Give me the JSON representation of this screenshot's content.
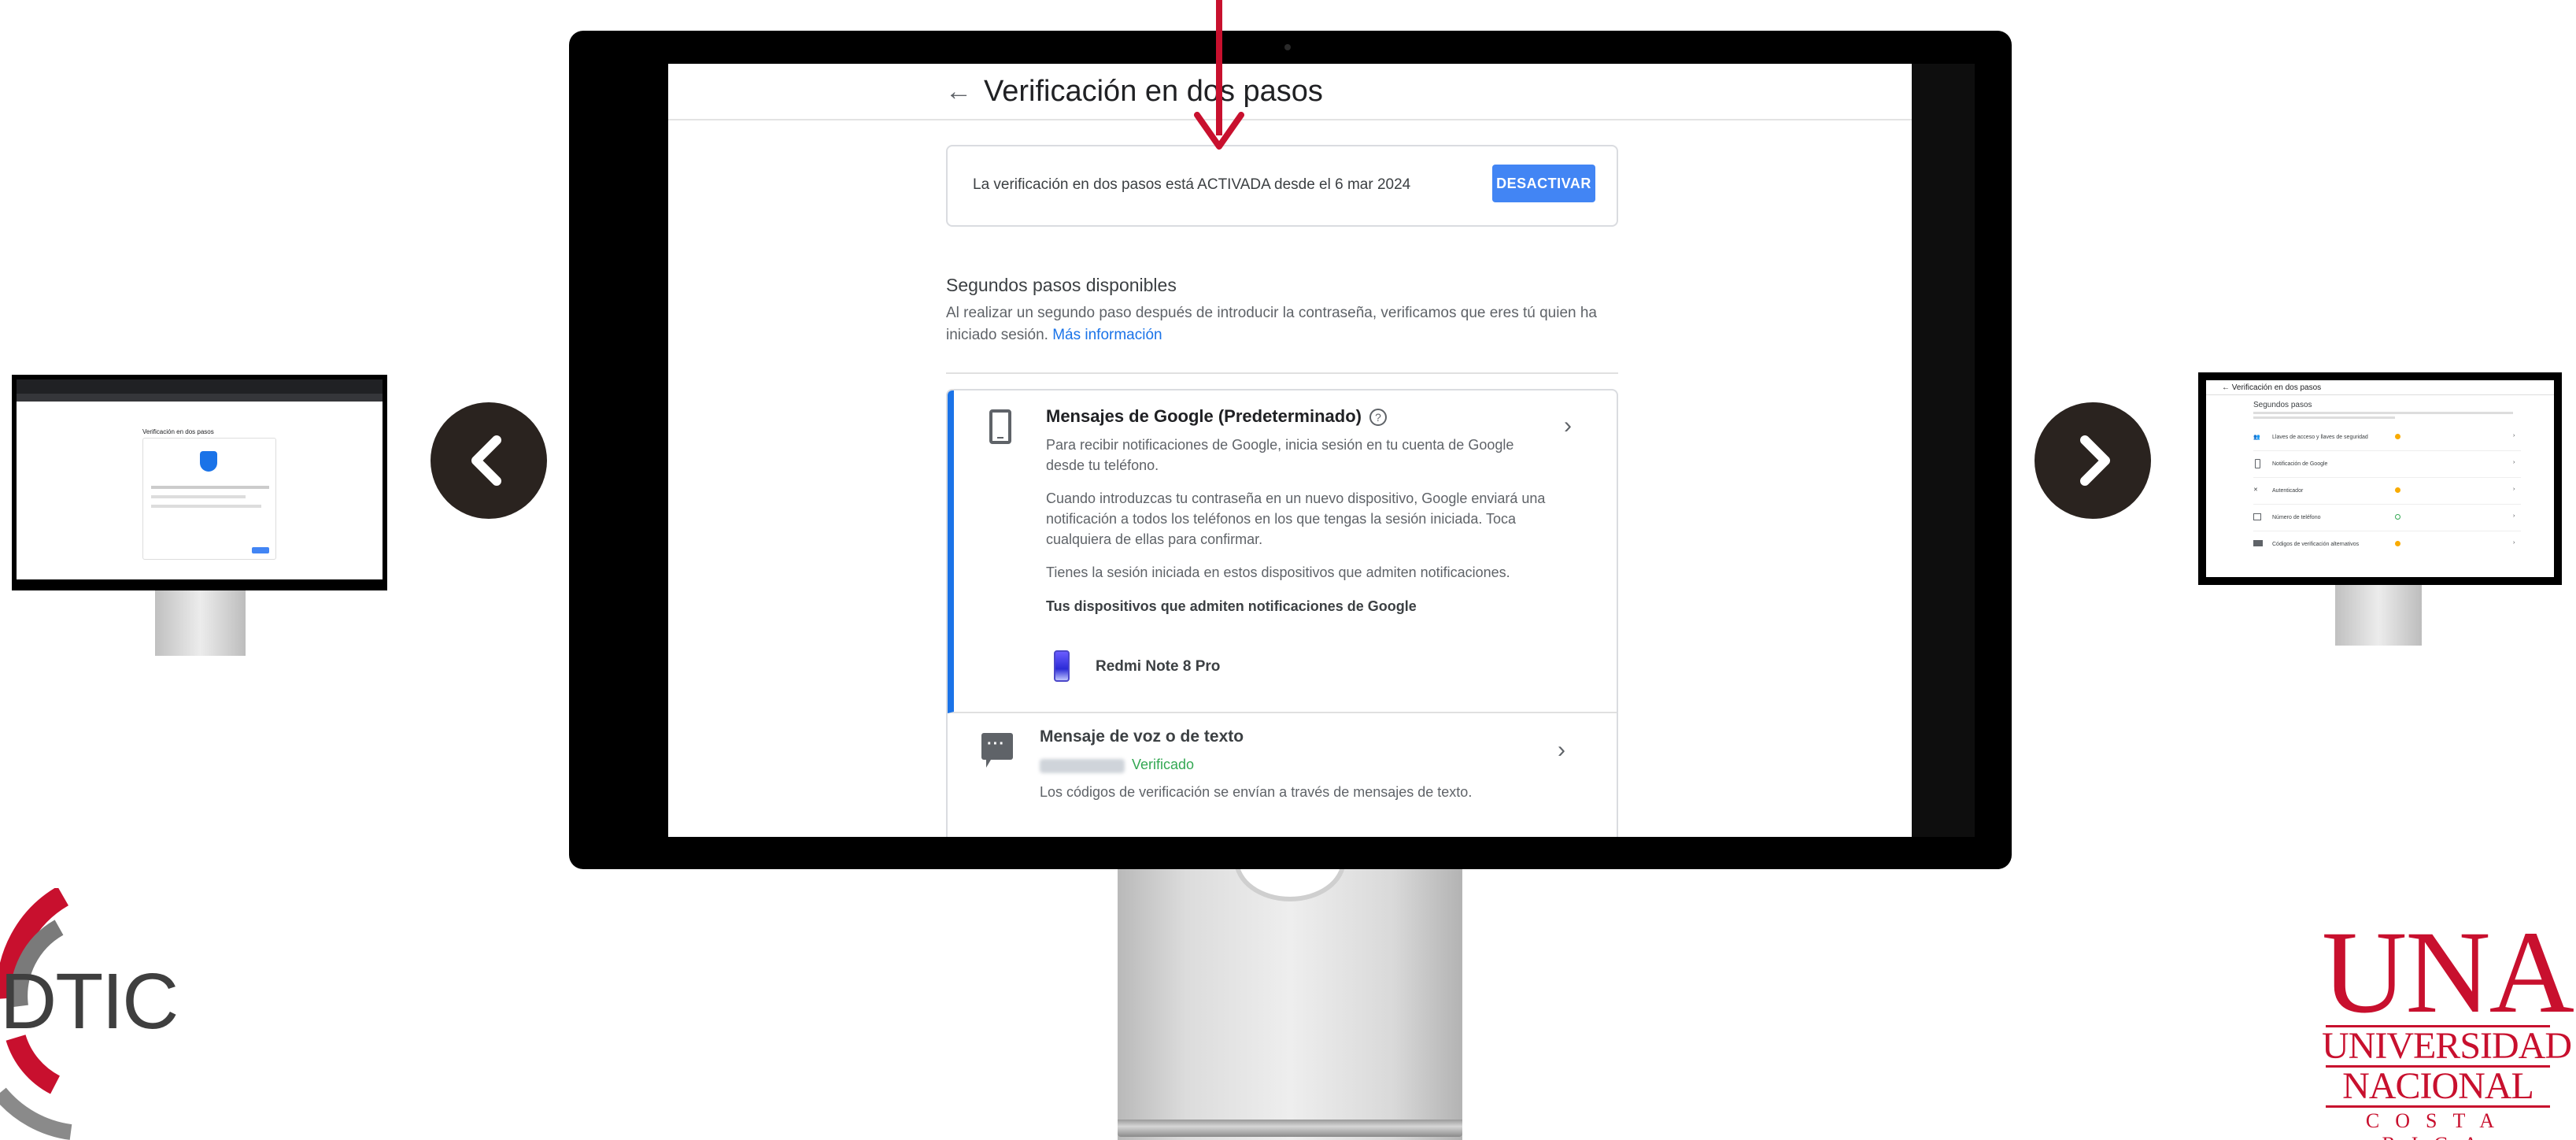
{
  "header": {
    "back_icon": "arrow-left-icon",
    "title": "Verificación en dos pasos"
  },
  "status": {
    "text": "La verificación en dos pasos está ACTIVADA desde el 6 mar 2024",
    "button_label": "DESACTIVAR"
  },
  "second_steps": {
    "title": "Segundos pasos disponibles",
    "description": "Al realizar un segundo paso después de introducir la contraseña, verificamos que eres tú quien ha iniciado sesión.",
    "link": "Más información"
  },
  "google_prompts": {
    "icon": "phone-icon",
    "title": "Mensajes de Google (Predeterminado)",
    "help_icon": "help-circle-icon",
    "p1": "Para recibir notificaciones de Google, inicia sesión en tu cuenta de Google desde tu teléfono.",
    "p2": "Cuando introduzcas tu contraseña en un nuevo dispositivo, Google enviará una notificación a todos los teléfonos en los que tengas la sesión iniciada. Toca cualquiera de ellas para confirmar.",
    "p3": "Tienes la sesión iniciada en estos dispositivos que admiten notificaciones.",
    "devices_heading": "Tus dispositivos que admiten notificaciones de Google",
    "device_name": "Redmi Note 8 Pro"
  },
  "voice_text": {
    "icon": "message-icon",
    "title": "Mensaje de voz o de texto",
    "status": "Verificado",
    "description": "Los códigos de verificación se envían a través de mensajes de texto."
  },
  "navigation": {
    "prev_icon": "chevron-left-icon",
    "next_icon": "chevron-right-icon"
  },
  "mini_right": {
    "title": "Verificación en dos pasos",
    "heading": "Segundos pasos",
    "rows": [
      "Llaves de acceso y llaves de seguridad",
      "Notificación de Google",
      "Autenticador",
      "Número de teléfono",
      "Códigos de verificación alternativos"
    ]
  },
  "mini_left": {
    "title": "Verificación en dos pasos"
  },
  "logos": {
    "left_text": "DTIC",
    "una_big": "UNA",
    "una_line1": "UNIVERSIDAD",
    "una_line2": "NACIONAL",
    "una_line3": "COSTA RICA"
  },
  "colors": {
    "accent_blue": "#4285f4",
    "link_blue": "#1a73e8",
    "verified_green": "#34a853",
    "una_red": "#c8102e"
  }
}
